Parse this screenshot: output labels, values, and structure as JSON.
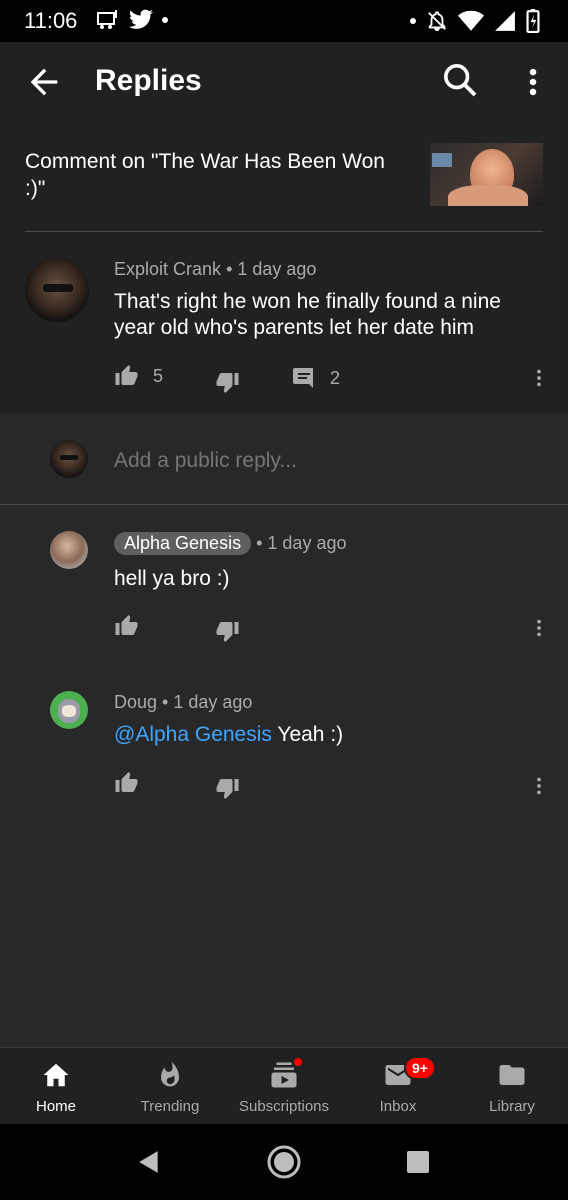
{
  "status_bar": {
    "time": "11:06"
  },
  "app_bar": {
    "title": "Replies"
  },
  "comment_header": {
    "text": "Comment on \"The War Has Been Won :)\""
  },
  "main_comment": {
    "author": "Exploit Crank",
    "time": "1 day ago",
    "text": "That's right he won he finally found  a nine year old who's parents let her date him",
    "likes": "5",
    "replies": "2"
  },
  "reply_input": {
    "placeholder": "Add a public reply..."
  },
  "replies": [
    {
      "author": "Alpha Genesis",
      "time": "1 day ago",
      "text": "hell ya bro :)"
    },
    {
      "author": "Doug",
      "time": "1 day ago",
      "mention": "@Alpha Genesis",
      "text": " Yeah :)"
    }
  ],
  "bottom_nav": {
    "items": [
      {
        "label": "Home",
        "icon": "home-icon"
      },
      {
        "label": "Trending",
        "icon": "flame-icon"
      },
      {
        "label": "Subscriptions",
        "icon": "subscriptions-icon"
      },
      {
        "label": "Inbox",
        "icon": "inbox-icon"
      },
      {
        "label": "Library",
        "icon": "library-folder-icon"
      }
    ],
    "inbox_badge": "9+"
  },
  "colors": {
    "background": "#282828",
    "surface": "#212121",
    "accent_link": "#3ea6ff",
    "badge": "#ff0000"
  }
}
